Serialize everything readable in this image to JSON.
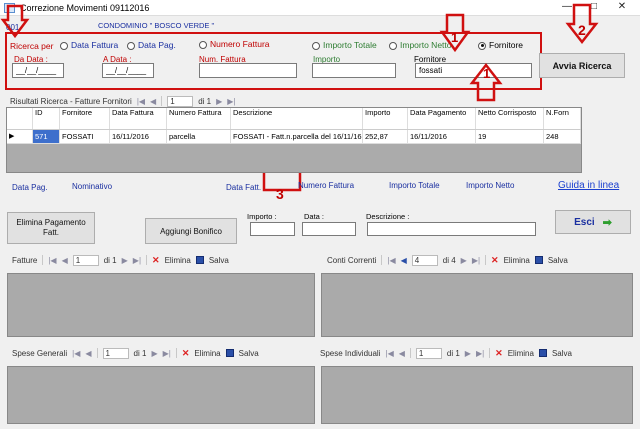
{
  "window": {
    "title": "Correzione Movimenti 09112016",
    "minimize": "—",
    "maximize": "□",
    "close": "✕"
  },
  "header": {
    "code": "001",
    "condominio": "CONDOMINIO \" BOSCO VERDE \""
  },
  "search": {
    "label": "Ricerca per",
    "options": [
      {
        "label": "Data Fattura",
        "selected": false
      },
      {
        "label": "Data Pag.",
        "selected": false
      },
      {
        "label": "Numero Fattura",
        "selected": false
      },
      {
        "label": "Importo Totale",
        "selected": false
      },
      {
        "label": "Importo Netto",
        "selected": false
      },
      {
        "label": "Fornitore",
        "selected": true
      }
    ],
    "da_data_label": "Da Data :",
    "da_data_value": "__/__/____",
    "a_data_label": "A Data :",
    "a_data_value": "__/__/____",
    "num_fattura_label": "Num. Fattura",
    "num_fattura_value": "",
    "importo_label": "Importo",
    "importo_value": "",
    "fornitore_label": "Fornitore",
    "fornitore_value": "fossati",
    "search_button": "Avvia Ricerca"
  },
  "annotations": {
    "n1": "1",
    "n2": "2",
    "n3": "3"
  },
  "results": {
    "label": "Risultati Ricerca -  Fatture Fornitori",
    "position": "1",
    "of": "di 1",
    "columns": [
      "ID",
      "Fornitore",
      "Data Fattura",
      "Numero Fattura",
      "Descrizione",
      "Importo",
      "Data Pagamento",
      "Netto Corrisposto",
      "N.Forn"
    ],
    "rows": [
      [
        "571",
        "FOSSATI",
        "16/11/2016",
        "parcella",
        "FOSSATI - Fatt.n.parcella del 16/11/16",
        "252,87",
        "16/11/2016",
        "19",
        "248"
      ]
    ]
  },
  "detail": {
    "data_pag": "Data Pag.",
    "nominativo": "Nominativo",
    "data_fatt": "Data Fatt.",
    "numero_fattura": "Numero Fattura",
    "importo_totale": "Importo Totale",
    "importo_netto": "Importo Netto",
    "guida": "Guida in linea"
  },
  "actions": {
    "elimina_pagamento": "Elimina Pagamento Fatt.",
    "aggiungi_bonifico": "Aggiungi Bonifico",
    "importo_label": "Importo :",
    "data_label": "Data :",
    "descrizione_label": "Descrizione :",
    "esci": "Esci"
  },
  "fatture_nav": {
    "label": "Fatture",
    "position": "1",
    "of": "di 1",
    "elimina": "Elimina",
    "salva": "Salva"
  },
  "conti_nav": {
    "label": "Conti Correnti",
    "position": "4",
    "of": "di 4",
    "elimina": "Elimina",
    "salva": "Salva"
  },
  "spese_generali_nav": {
    "label": "Spese Generali",
    "position": "1",
    "of": "di 1",
    "elimina": "Elimina",
    "salva": "Salva"
  },
  "spese_individuali_nav": {
    "label": "Spese Individuali",
    "position": "1",
    "of": "di 1",
    "elimina": "Elimina",
    "salva": "Salva"
  },
  "colors": {
    "accent_red": "#c00000",
    "label_blue": "#1a2fa0",
    "panel_gray": "#aaaaaa"
  },
  "icons": [
    "first-icon",
    "prev-icon",
    "next-icon",
    "last-icon",
    "delete-icon",
    "save-icon",
    "exit-arrow-icon",
    "row-pointer-icon"
  ]
}
